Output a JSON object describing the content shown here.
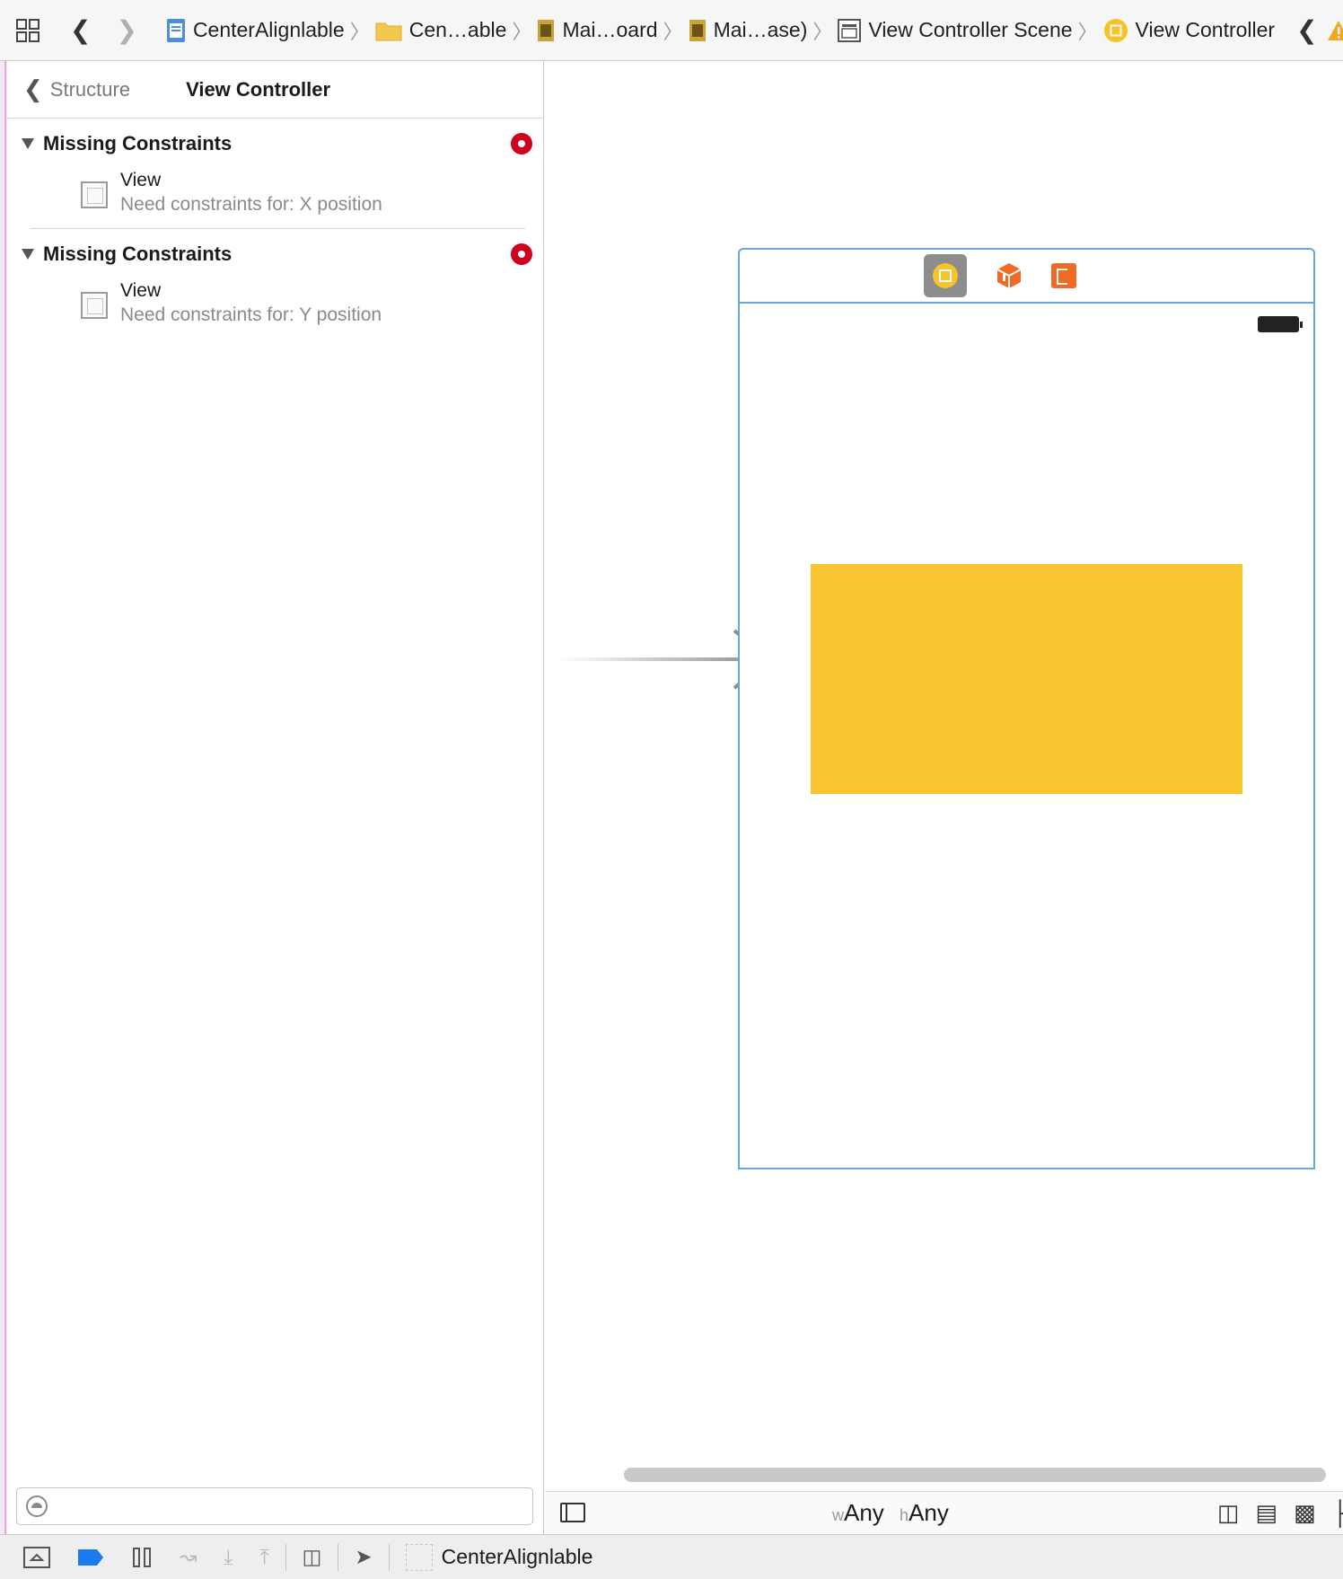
{
  "jumpbar": {
    "crumbs": [
      {
        "label": "CenterAlignlable",
        "icon": "project-file-icon"
      },
      {
        "label": "Cen…able",
        "icon": "folder-icon"
      },
      {
        "label": "Mai…oard",
        "icon": "storyboard-file-icon"
      },
      {
        "label": "Mai…ase)",
        "icon": "storyboard-file-icon"
      },
      {
        "label": "View Controller Scene",
        "icon": "scene-icon"
      },
      {
        "label": "View Controller",
        "icon": "view-controller-icon"
      }
    ],
    "warning_color": "#f5a623"
  },
  "issues": {
    "back_label": "Structure",
    "title": "View Controller",
    "groups": [
      {
        "title": "Missing Constraints",
        "item_name": "View",
        "item_detail": "Need constraints for: X position"
      },
      {
        "title": "Missing Constraints",
        "item_name": "View",
        "item_detail": "Need constraints for: Y position"
      }
    ],
    "error_color": "#d0021b"
  },
  "canvas": {
    "view_color": "#f8c52f",
    "size_class": {
      "w_prefix": "w",
      "w_value": "Any",
      "h_prefix": "h",
      "h_value": "Any"
    }
  },
  "debugbar": {
    "target_label": "CenterAlignlable"
  }
}
